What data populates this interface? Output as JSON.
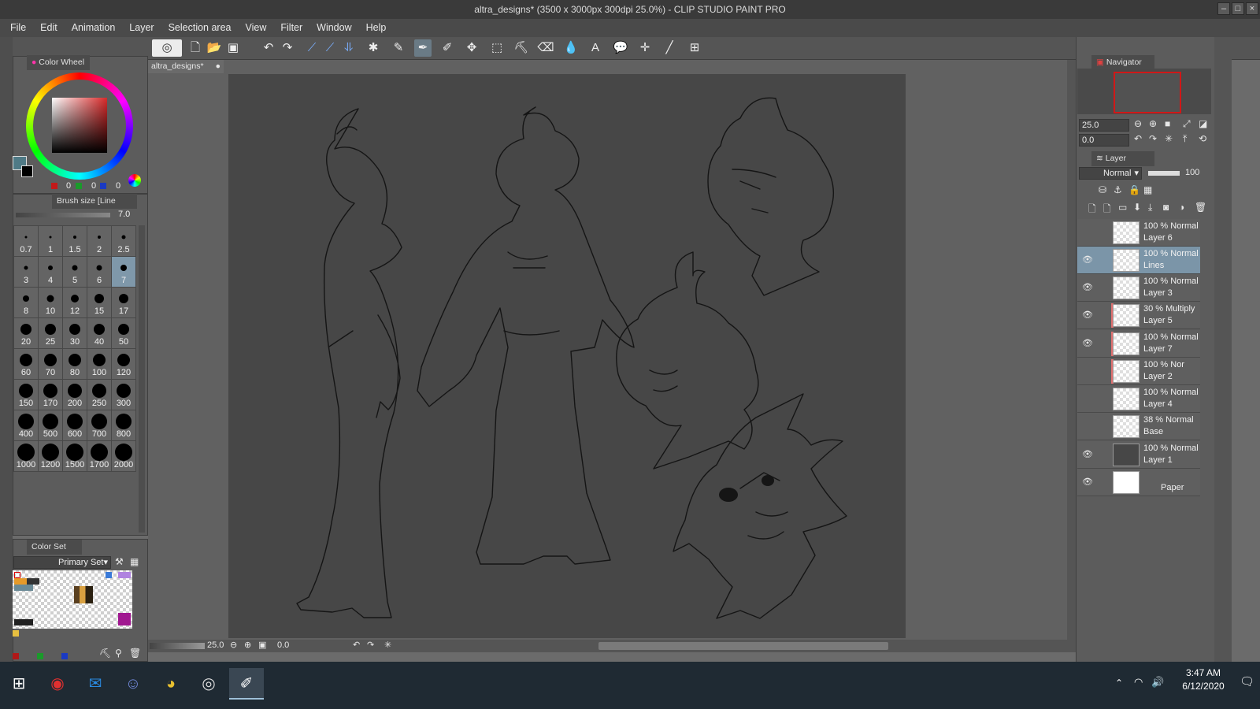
{
  "window": {
    "title": "altra_designs* (3500 x 3000px 300dpi 25.0%)  - CLIP STUDIO PAINT PRO",
    "controls": [
      "minimize-icon",
      "maximize-icon",
      "close-icon"
    ]
  },
  "menu": [
    "File",
    "Edit",
    "Animation",
    "Layer",
    "Selection area",
    "View",
    "Filter",
    "Window",
    "Help"
  ],
  "toolbar": {
    "icons": [
      "clip-studio-logo-icon",
      "new-file-icon",
      "open-file-icon",
      "save-icon",
      "undo-icon",
      "redo-icon",
      "pen-icon",
      "pen-pressure-icon",
      "stabilizer-icon",
      "settings-icon",
      "eyedropper-icon",
      "pen-tool-icon",
      "brush-tool-icon",
      "move-tool-icon",
      "selection-tool-icon",
      "auto-select-icon",
      "eraser-icon",
      "fill-icon",
      "text-icon",
      "balloon-icon",
      "ruler-icon",
      "line-icon",
      "frame-icon"
    ]
  },
  "color_wheel": {
    "tab_label": "Color Wheel",
    "r": "0",
    "g": "0",
    "b": "0",
    "main_color": "#4f7a86",
    "sub_color": "#000000"
  },
  "brush_size": {
    "tab_label": "Brush size [Line",
    "value": "7.0",
    "selected": "7",
    "sizes": [
      "0.7",
      "1",
      "1.5",
      "2",
      "2.5",
      "3",
      "4",
      "5",
      "6",
      "7",
      "8",
      "10",
      "12",
      "15",
      "17",
      "20",
      "25",
      "30",
      "40",
      "50",
      "60",
      "70",
      "80",
      "100",
      "120",
      "150",
      "170",
      "200",
      "250",
      "300",
      "400",
      "500",
      "600",
      "700",
      "800",
      "1000",
      "1200",
      "1500",
      "1700",
      "2000"
    ]
  },
  "color_set": {
    "tab_label": "Color Set",
    "set_name": "Primary Set"
  },
  "document": {
    "tab_label": "altra_designs*",
    "zoom": "25.0",
    "rotation": "0.0"
  },
  "navigator": {
    "tab_label": "Navigator",
    "zoom": "25.0",
    "rotation": "0.0"
  },
  "layer_panel": {
    "tab_label": "Layer",
    "blend_mode": "Normal",
    "opacity": "100",
    "layers": [
      {
        "mode": "100 % Normal",
        "name": "Layer 6",
        "visible": false,
        "selected": false,
        "clip": false
      },
      {
        "mode": "100 % Normal",
        "name": "Lines",
        "visible": true,
        "selected": true,
        "clip": false
      },
      {
        "mode": "100 % Normal",
        "name": "Layer 3",
        "visible": true,
        "selected": false,
        "clip": false
      },
      {
        "mode": "30 % Multiply",
        "name": "Layer 5",
        "visible": true,
        "selected": false,
        "clip": true
      },
      {
        "mode": "100 % Normal",
        "name": "Layer 7",
        "visible": true,
        "selected": false,
        "clip": true
      },
      {
        "mode": "100 % Nor",
        "name": "Layer 2",
        "visible": false,
        "selected": false,
        "clip": true
      },
      {
        "mode": "100 % Normal",
        "name": "Layer 4",
        "visible": false,
        "selected": false,
        "clip": false
      },
      {
        "mode": "38 % Normal",
        "name": "Base",
        "visible": false,
        "selected": false,
        "clip": false
      },
      {
        "mode": "100 % Normal",
        "name": "Layer 1",
        "visible": true,
        "selected": false,
        "clip": false
      },
      {
        "mode": "",
        "name": "Paper",
        "visible": true,
        "selected": false,
        "clip": false
      }
    ]
  },
  "taskbar": {
    "apps": [
      "windows-start-icon",
      "app-red-icon",
      "mail-icon",
      "discord-icon",
      "chrome-icon",
      "clip-studio-icon",
      "clip-studio-paint-icon"
    ],
    "time": "3:47 AM",
    "date": "6/12/2020"
  }
}
